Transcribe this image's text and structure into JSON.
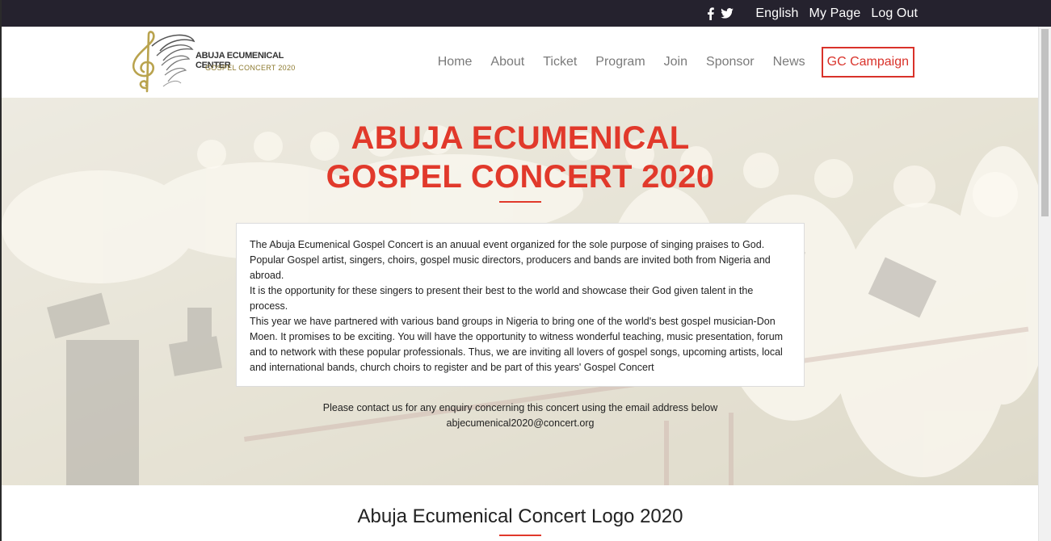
{
  "topbar": {
    "icons": [
      "facebook-icon",
      "twitter-icon"
    ],
    "links": [
      "English",
      "My Page",
      "Log Out"
    ]
  },
  "brand": {
    "line1": "ABUJA ECUMENICAL CENTER",
    "line2": "GOSPEL CONCERT 2020"
  },
  "nav": {
    "items": [
      "Home",
      "About",
      "Ticket",
      "Program",
      "Join",
      "Sponsor",
      "News"
    ],
    "cta": "GC Campaign"
  },
  "hero": {
    "title_line1": "ABUJA ECUMENICAL",
    "title_line2": "GOSPEL CONCERT 2020",
    "paragraphs": [
      "The Abuja Ecumenical Gospel Concert is an anuual event organized for the sole purpose of singing praises to God. Popular Gospel artist, singers, choirs, gospel music directors, producers and bands are invited both from Nigeria and abroad.",
      "It is the opportunity for these singers to present their best to the world and showcase their God given talent in the process.",
      "This year we have partnered with various band groups in Nigeria to bring one of the world's best gospel musician-Don Moen. It promises to be exciting. You will have the opportunity to witness wonderful teaching, music presentation, forum and to network with these popular professionals. Thus, we are inviting all lovers of gospel songs, upcoming artists, local and international bands, church choirs to register and be part of this years' Gospel Concert"
    ],
    "contact_line": "Please contact us for any enquiry concerning this concert using the email address below",
    "email": "abjecumenical2020@concert.org"
  },
  "section": {
    "title": "Abuja Ecumenical Concert Logo 2020"
  },
  "colors": {
    "accent": "#e1392b",
    "topbar_bg": "#25222e",
    "nav_text": "#7a7a7a"
  }
}
